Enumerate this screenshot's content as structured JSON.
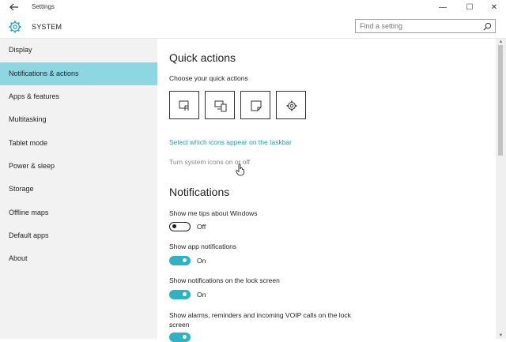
{
  "window": {
    "title": "Settings",
    "back_icon": "back-arrow-icon",
    "minimize": "—",
    "maximize": "☐",
    "close": "✕"
  },
  "header": {
    "icon": "gear-icon",
    "title": "SYSTEM",
    "search_placeholder": "Find a setting"
  },
  "sidebar": {
    "items": [
      {
        "label": "Display"
      },
      {
        "label": "Notifications & actions",
        "active": true
      },
      {
        "label": "Apps & features"
      },
      {
        "label": "Multitasking"
      },
      {
        "label": "Tablet mode"
      },
      {
        "label": "Power & sleep"
      },
      {
        "label": "Storage"
      },
      {
        "label": "Offline maps"
      },
      {
        "label": "Default apps"
      },
      {
        "label": "About"
      }
    ]
  },
  "quick_actions": {
    "heading": "Quick actions",
    "subheading": "Choose your quick actions",
    "tiles": [
      {
        "icon": "tablet-mode-icon"
      },
      {
        "icon": "connect-icon"
      },
      {
        "icon": "note-icon"
      },
      {
        "icon": "settings-gear-icon"
      }
    ],
    "link": "Select which icons appear on the taskbar",
    "disabled_link": "Turn system icons on or off"
  },
  "notifications": {
    "heading": "Notifications",
    "settings": [
      {
        "label": "Show me tips about Windows",
        "state": "Off",
        "on": false
      },
      {
        "label": "Show app notifications",
        "state": "On",
        "on": true
      },
      {
        "label": "Show notifications on the lock screen",
        "state": "On",
        "on": true
      },
      {
        "label": "Show alarms, reminders and incoming VOIP calls on the lock screen",
        "state": "On",
        "on": true
      }
    ]
  },
  "colors": {
    "accent": "#2eb3c4",
    "active_nav": "#8fd6e3",
    "link": "#1a9fb3"
  }
}
